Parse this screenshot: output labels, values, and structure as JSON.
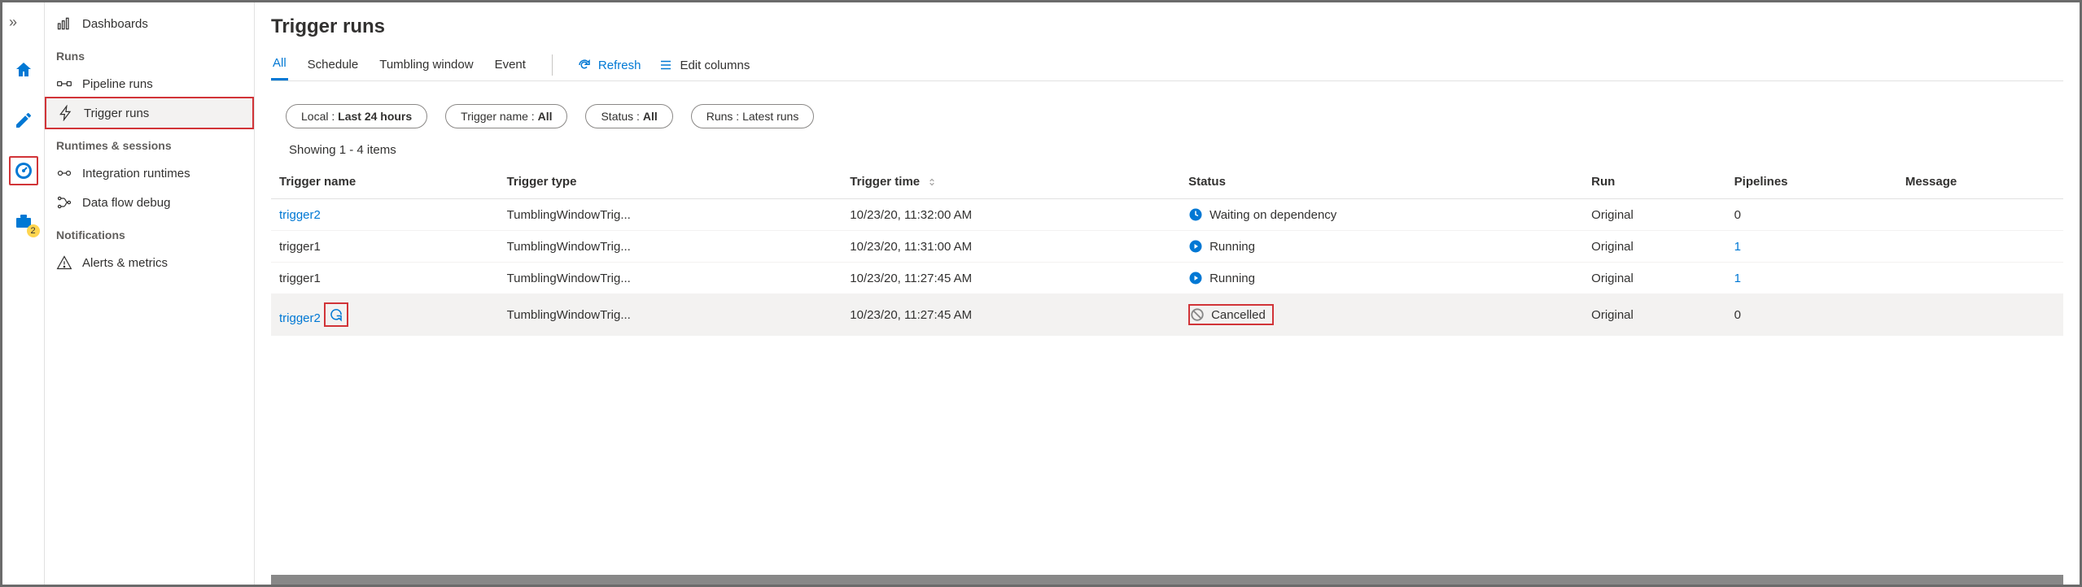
{
  "rail": {
    "badge": "2"
  },
  "sidebar": {
    "dashboards": "Dashboards",
    "sec_runs": "Runs",
    "pipeline_runs": "Pipeline runs",
    "trigger_runs": "Trigger runs",
    "sec_runtimes": "Runtimes & sessions",
    "integration_runtimes": "Integration runtimes",
    "dataflow_debug": "Data flow debug",
    "sec_notifications": "Notifications",
    "alerts": "Alerts & metrics"
  },
  "page": {
    "title": "Trigger runs",
    "tabs": {
      "all": "All",
      "schedule": "Schedule",
      "tumbling": "Tumbling window",
      "event": "Event"
    },
    "refresh": "Refresh",
    "edit_columns": "Edit columns",
    "summary": "Showing 1 - 4 items"
  },
  "filters": {
    "local_label": "Local : ",
    "local_value": "Last 24 hours",
    "trigger_label": "Trigger name : ",
    "trigger_value": "All",
    "status_label": "Status : ",
    "status_value": "All",
    "runs_label": "Runs : ",
    "runs_value": "Latest runs"
  },
  "columns": {
    "name": "Trigger name",
    "type": "Trigger type",
    "time": "Trigger time",
    "status": "Status",
    "run": "Run",
    "pipelines": "Pipelines",
    "message": "Message"
  },
  "rows": [
    {
      "name": "trigger2",
      "name_link": true,
      "type": "TumblingWindowTrig...",
      "time": "10/23/20, 11:32:00 AM",
      "status": "Waiting on dependency",
      "status_kind": "waiting",
      "run": "Original",
      "pipelines": "0",
      "pipelines_link": false,
      "rerun": false,
      "highlight_status": false
    },
    {
      "name": "trigger1",
      "name_link": false,
      "type": "TumblingWindowTrig...",
      "time": "10/23/20, 11:31:00 AM",
      "status": "Running",
      "status_kind": "running",
      "run": "Original",
      "pipelines": "1",
      "pipelines_link": true,
      "rerun": false,
      "highlight_status": false
    },
    {
      "name": "trigger1",
      "name_link": false,
      "type": "TumblingWindowTrig...",
      "time": "10/23/20, 11:27:45 AM",
      "status": "Running",
      "status_kind": "running",
      "run": "Original",
      "pipelines": "1",
      "pipelines_link": true,
      "rerun": false,
      "highlight_status": false
    },
    {
      "name": "trigger2",
      "name_link": true,
      "type": "TumblingWindowTrig...",
      "time": "10/23/20, 11:27:45 AM",
      "status": "Cancelled",
      "status_kind": "cancelled",
      "run": "Original",
      "pipelines": "0",
      "pipelines_link": false,
      "rerun": true,
      "highlight_status": true
    }
  ]
}
